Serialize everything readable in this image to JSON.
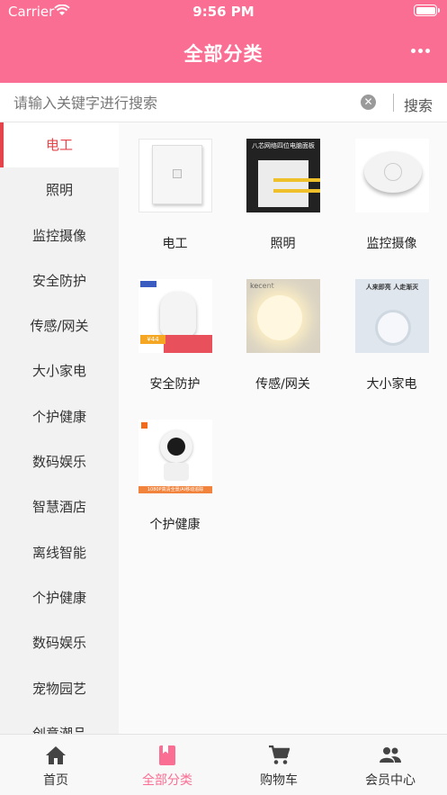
{
  "status_bar": {
    "carrier": "Carrier",
    "time": "9:56 PM"
  },
  "header": {
    "title": "全部分类",
    "more_icon": "more-dots-icon"
  },
  "search": {
    "placeholder": "请输入关键字进行搜索",
    "value": "",
    "clear_icon": "clear-icon",
    "button_label": "搜索"
  },
  "sidebar": {
    "active_index": 0,
    "items": [
      {
        "label": "电工"
      },
      {
        "label": "照明"
      },
      {
        "label": "监控摄像"
      },
      {
        "label": "安全防护"
      },
      {
        "label": "传感/网关"
      },
      {
        "label": "大小家电"
      },
      {
        "label": "个护健康"
      },
      {
        "label": "数码娱乐"
      },
      {
        "label": "智慧酒店"
      },
      {
        "label": "离线智能"
      },
      {
        "label": "个护健康"
      },
      {
        "label": "数码娱乐"
      },
      {
        "label": "宠物园艺"
      },
      {
        "label": "创意潮品"
      }
    ]
  },
  "grid": {
    "items": [
      {
        "label": "电工",
        "image": "wall-switch-panel"
      },
      {
        "label": "照明",
        "image": "network-socket-panel",
        "image_text": "八芯网络四位电脑面板"
      },
      {
        "label": "监控摄像",
        "image": "smoke-detector"
      },
      {
        "label": "安全防护",
        "image": "motion-night-light",
        "image_text": "¥44"
      },
      {
        "label": "传感/网关",
        "image": "wall-lamp",
        "image_text": "kecent"
      },
      {
        "label": "大小家电",
        "image": "ceiling-sensor-light",
        "image_text": "人来即亮 人走渐灭"
      },
      {
        "label": "个护健康",
        "image": "home-camera",
        "image_text": "1080P高清全景/AI移动追踪"
      }
    ]
  },
  "tabbar": {
    "active_index": 1,
    "tabs": [
      {
        "label": "首页",
        "icon": "home-icon"
      },
      {
        "label": "全部分类",
        "icon": "category-book-icon"
      },
      {
        "label": "购物车",
        "icon": "cart-icon"
      },
      {
        "label": "会员中心",
        "icon": "members-icon"
      }
    ]
  },
  "colors": {
    "brand": "#fb6e93",
    "active_text": "#e5454a",
    "sidebar_bg": "#f2f2f2"
  }
}
